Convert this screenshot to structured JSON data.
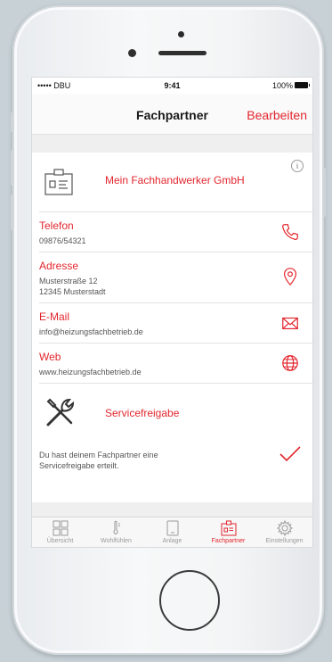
{
  "status_bar": {
    "carrier": "••••• DBU",
    "time": "9:41",
    "battery": "100%"
  },
  "nav": {
    "title": "Fachpartner",
    "edit_label": "Bearbeiten"
  },
  "company": {
    "name": "Mein Fachhandwerker GmbH",
    "info_glyph": "i"
  },
  "rows": {
    "phone": {
      "label": "Telefon",
      "value": "09876/54321",
      "icon": "phone-icon"
    },
    "address": {
      "label": "Adresse",
      "line1": "Musterstraße 12",
      "line2": "12345 Musterstadt",
      "icon": "location-pin-icon"
    },
    "email": {
      "label": "E-Mail",
      "value": "info@heizungsfachbetrieb.de",
      "icon": "envelope-icon"
    },
    "web": {
      "label": "Web",
      "value": "www.heizungsfachbetrieb.de",
      "icon": "globe-icon"
    }
  },
  "service": {
    "title": "Servicefreigabe",
    "description_line1": "Du hast deinem Fachpartner eine",
    "description_line2": "Servicefreigabe erteilt.",
    "icon": "tools-icon",
    "status_icon": "checkmark-icon"
  },
  "tabs": [
    {
      "label": "Übersicht",
      "icon": "grid-icon",
      "active": false
    },
    {
      "label": "Wohlfühlen",
      "icon": "thermometer-icon",
      "active": false
    },
    {
      "label": "Anlage",
      "icon": "device-icon",
      "active": false
    },
    {
      "label": "Fachpartner",
      "icon": "id-card-icon",
      "active": true
    },
    {
      "label": "Einstellungen",
      "icon": "gear-icon",
      "active": false
    }
  ],
  "colors": {
    "accent": "#e3262e",
    "text_secondary": "#555555",
    "background": "#efefef"
  }
}
